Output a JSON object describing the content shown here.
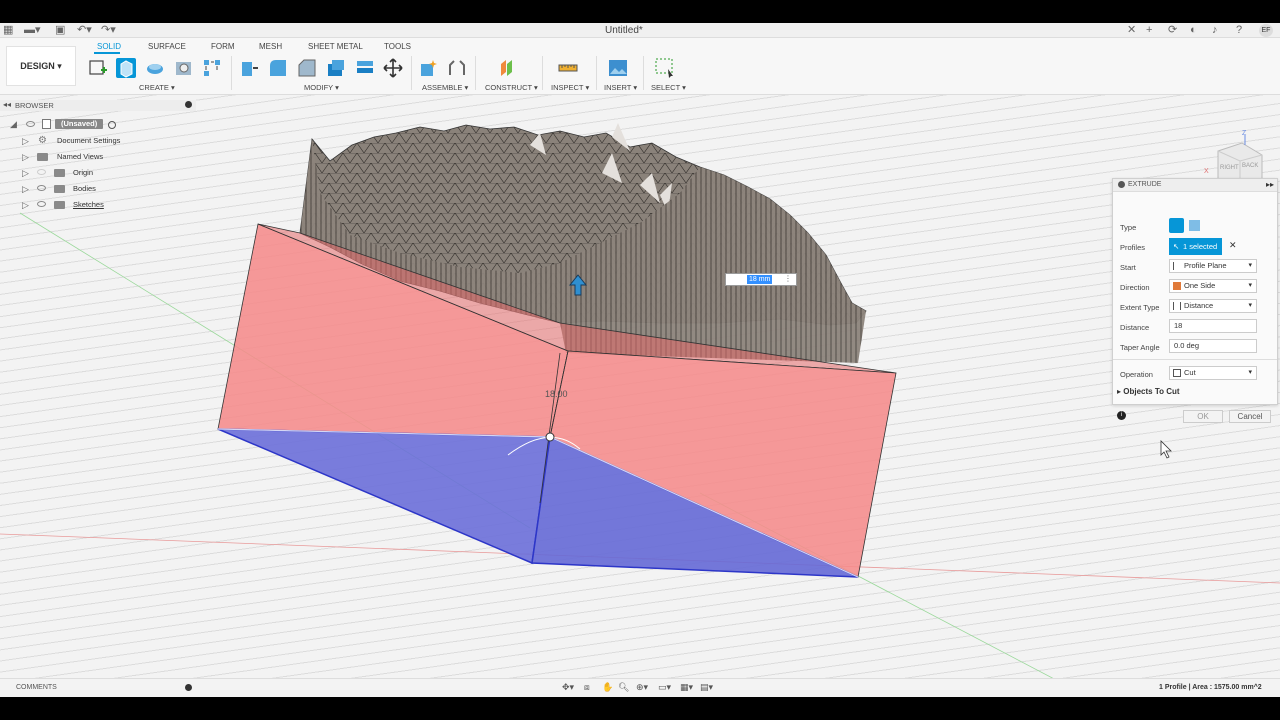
{
  "app": {
    "doc_title": "Untitled*",
    "user_initials": "EF"
  },
  "toolbar": {
    "workspace_label": "DESIGN",
    "tabs": [
      "SOLID",
      "SURFACE",
      "FORM",
      "MESH",
      "SHEET METAL",
      "TOOLS"
    ],
    "groups": [
      "CREATE",
      "MODIFY",
      "ASSEMBLE",
      "CONSTRUCT",
      "INSPECT",
      "INSERT",
      "SELECT"
    ]
  },
  "browser": {
    "title": "BROWSER",
    "root": "(Unsaved)",
    "items": [
      "Document Settings",
      "Named Views",
      "Origin",
      "Bodies",
      "Sketches"
    ]
  },
  "viewcube": {
    "faces": [
      "RIGHT",
      "BACK"
    ],
    "axis_labels": [
      "Z",
      "X"
    ]
  },
  "viewport": {
    "dimension_label": "18.00",
    "dimension_input": "18 mm"
  },
  "extrude": {
    "title": "EXTRUDE",
    "labels": {
      "type": "Type",
      "profiles": "Profiles",
      "start": "Start",
      "direction": "Direction",
      "extent_type": "Extent Type",
      "distance": "Distance",
      "taper_angle": "Taper Angle",
      "operation": "Operation"
    },
    "values": {
      "profiles": "1 selected",
      "start": "Profile Plane",
      "direction": "One Side",
      "extent_type": "Distance",
      "distance": "18",
      "taper_angle": "0.0 deg",
      "operation": "Cut"
    },
    "objects_to_cut": "Objects To Cut",
    "ok": "OK",
    "cancel": "Cancel"
  },
  "status": {
    "comments": "COMMENTS",
    "selection": "1 Profile | Area : 1575.00 mm^2"
  },
  "colors": {
    "accent": "#0696d7",
    "cut_face": "#f08a8a",
    "bottom_face": "#6a6ad8",
    "terrain": "#7a7470"
  }
}
